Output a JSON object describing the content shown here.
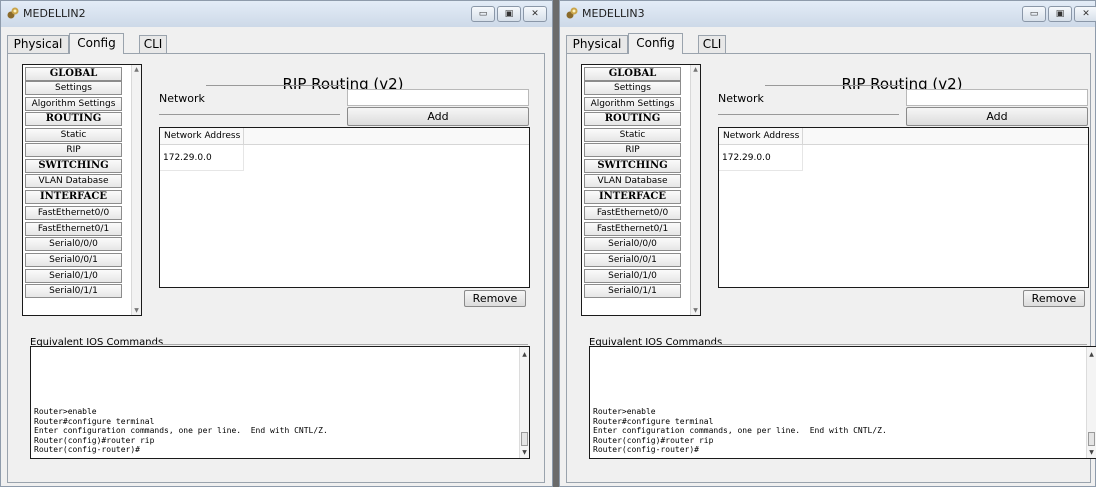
{
  "windows": [
    {
      "title": "MEDELLIN2",
      "tabs": [
        "Physical",
        "Config",
        "CLI"
      ],
      "active_tab": "Config",
      "nav_items": [
        "GLOBAL",
        "Settings",
        "Algorithm Settings",
        "ROUTING",
        "Static",
        "RIP",
        "SWITCHING",
        "VLAN Database",
        "INTERFACE",
        "FastEthernet0/0",
        "FastEthernet0/1",
        "Serial0/0/0",
        "Serial0/0/1",
        "Serial0/1/0",
        "Serial0/1/1"
      ],
      "rip_title": "RIP Routing (v2)",
      "network_label": "Network",
      "network_value": "",
      "add_label": "Add",
      "table_header": "Network Address",
      "table_rows": [
        "172.29.0.0"
      ],
      "remove_label": "Remove",
      "ios_title": "Equivalent IOS Commands",
      "console_text": "Router>enable\nRouter#configure terminal\nEnter configuration commands, one per line.  End with CNTL/Z.\nRouter(config)#router rip\nRouter(config-router)#"
    },
    {
      "title": "MEDELLIN3",
      "tabs": [
        "Physical",
        "Config",
        "CLI"
      ],
      "active_tab": "Config",
      "nav_items": [
        "GLOBAL",
        "Settings",
        "Algorithm Settings",
        "ROUTING",
        "Static",
        "RIP",
        "SWITCHING",
        "VLAN Database",
        "INTERFACE",
        "FastEthernet0/0",
        "FastEthernet0/1",
        "Serial0/0/0",
        "Serial0/0/1",
        "Serial0/1/0",
        "Serial0/1/1"
      ],
      "rip_title": "RIP Routing (v2)",
      "network_label": "Network",
      "network_value": "",
      "add_label": "Add",
      "table_header": "Network Address",
      "table_rows": [
        "172.29.0.0"
      ],
      "remove_label": "Remove",
      "ios_title": "Equivalent IOS Commands",
      "console_text": "Router>enable\nRouter#configure terminal\nEnter configuration commands, one per line.  End with CNTL/Z.\nRouter(config)#router rip\nRouter(config-router)#"
    }
  ],
  "icons": {
    "app": "packet-tracer-router-icon",
    "minimize": "minimize-icon",
    "maximize": "maximize-icon",
    "close": "close-icon"
  },
  "colors": {
    "titlebar": "#d7e2ef",
    "panel": "#f0f0f0",
    "border": "#1a1a1a"
  }
}
